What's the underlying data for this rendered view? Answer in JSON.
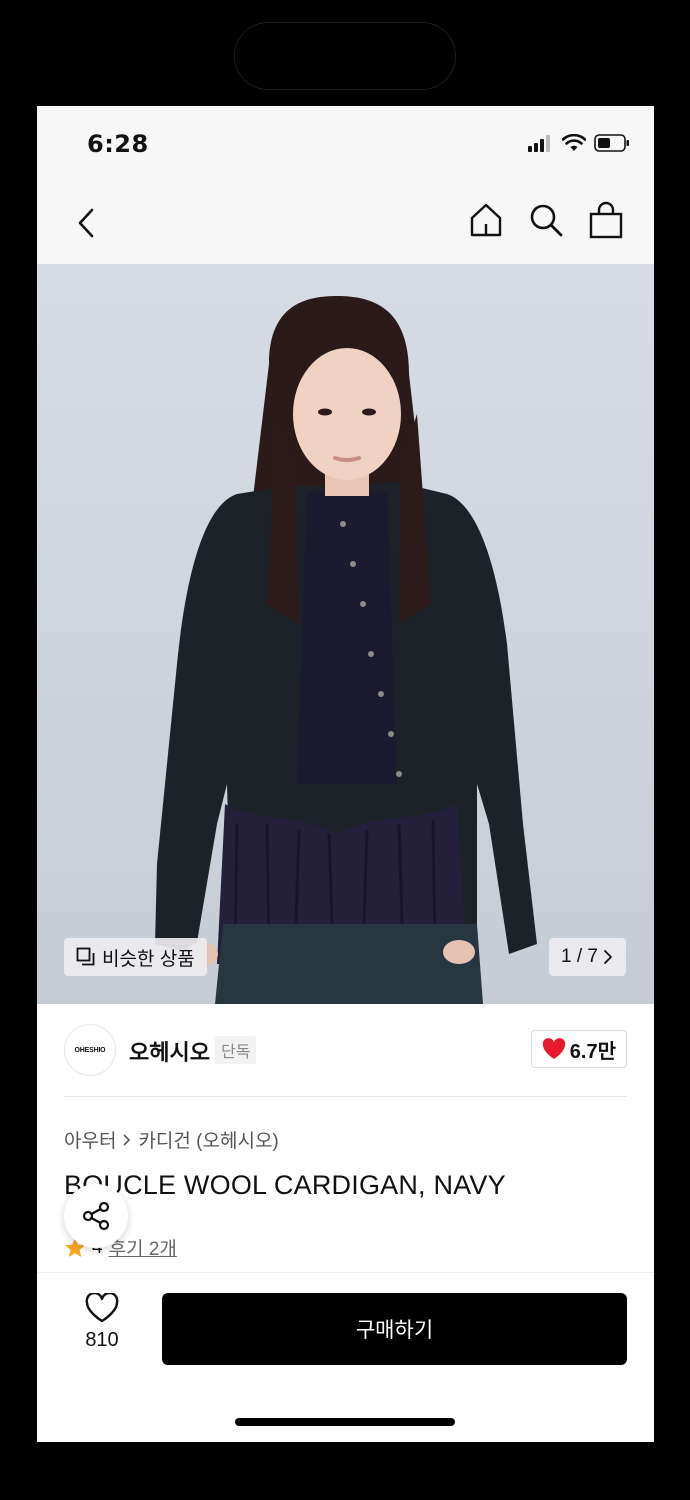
{
  "status_bar": {
    "time": "6:28",
    "icons": [
      "signal-icon",
      "wifi-icon",
      "battery-icon"
    ]
  },
  "nav": {
    "icons": [
      "back-icon",
      "home-icon",
      "search-icon",
      "bag-icon"
    ]
  },
  "hero": {
    "similar_label": "비슷한 상품",
    "counter": "1 / 7",
    "current_image": 1,
    "total_images": 7
  },
  "brand": {
    "logo_text": "OHESHIO",
    "name": "오헤시오",
    "badge": "단독",
    "likes": "6.7만"
  },
  "product": {
    "breadcrumb": [
      "아우터",
      "카디건 (오헤시오)"
    ],
    "title": "BOUCLE WOOL CARDIGAN, NAVY",
    "rating": "4",
    "reviews": "후기 2개"
  },
  "bottom_bar": {
    "wish_count": "810",
    "buy_label": "구매하기"
  },
  "colors": {
    "accent_star": "#f5a623",
    "heart_red": "#e8192c",
    "cta_bg": "#000000"
  }
}
